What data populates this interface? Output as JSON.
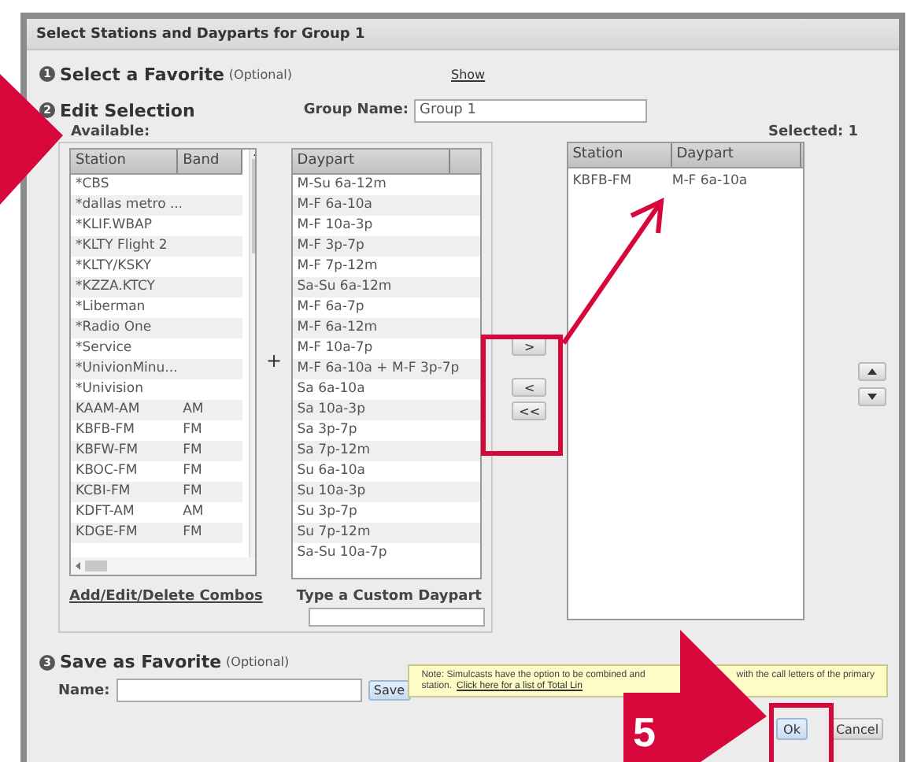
{
  "window": {
    "title": "Select Stations and Dayparts for Group 1"
  },
  "favorite": {
    "number": "1",
    "title": "Select a Favorite",
    "hint": "(Optional)",
    "link": "Show"
  },
  "edit": {
    "number": "2",
    "title": "Edit Selection",
    "group_label": "Group Name:",
    "group_value": "Group 1",
    "available_label": "Available:",
    "selected_label": "Selected: 1"
  },
  "stations": {
    "columns": [
      "Station",
      "Band"
    ],
    "rows": [
      {
        "station": "*CBS",
        "band": ""
      },
      {
        "station": "*dallas metro ...",
        "band": ""
      },
      {
        "station": "*KLIF.WBAP",
        "band": ""
      },
      {
        "station": "*KLTY Flight 2",
        "band": ""
      },
      {
        "station": "*KLTY/KSKY",
        "band": ""
      },
      {
        "station": "*KZZA.KTCY",
        "band": ""
      },
      {
        "station": "*Liberman",
        "band": ""
      },
      {
        "station": "*Radio One",
        "band": ""
      },
      {
        "station": "*Service",
        "band": ""
      },
      {
        "station": "*UnivionMinu...",
        "band": ""
      },
      {
        "station": "*Univision",
        "band": ""
      },
      {
        "station": "KAAM-AM",
        "band": "AM"
      },
      {
        "station": "KBFB-FM",
        "band": "FM"
      },
      {
        "station": "KBFW-FM",
        "band": "FM"
      },
      {
        "station": "KBOC-FM",
        "band": "FM"
      },
      {
        "station": "KCBI-FM",
        "band": "FM"
      },
      {
        "station": "KDFT-AM",
        "band": "AM"
      },
      {
        "station": "KDGE-FM",
        "band": "FM"
      }
    ]
  },
  "plus": "+",
  "dayparts": {
    "column": "Daypart",
    "rows": [
      "M-Su 6a-12m",
      "M-F 6a-10a",
      "M-F 10a-3p",
      "M-F 3p-7p",
      "M-F 7p-12m",
      "Sa-Su 6a-12m",
      "M-F 6a-7p",
      "M-F 6a-12m",
      "M-F 10a-7p",
      "M-F 6a-10a + M-F 3p-7p",
      "Sa 6a-10a",
      "Sa 10a-3p",
      "Sa 3p-7p",
      "Sa 7p-12m",
      "Su 6a-10a",
      "Su 10a-3p",
      "Su 3p-7p",
      "Su 7p-12m",
      "Sa-Su 10a-7p"
    ]
  },
  "combos_link": "Add/Edit/Delete Combos",
  "custom_label": "Type a Custom Daypart",
  "move_buttons": [
    ">",
    "<",
    "<<"
  ],
  "selected": {
    "columns": [
      "Station",
      "Daypart"
    ],
    "rows": [
      {
        "station": "KBFB-FM",
        "daypart": "M-F 6a-10a"
      }
    ]
  },
  "save": {
    "number": "3",
    "title": "Save as Favorite",
    "hint": "(Optional)",
    "name_label": "Name:",
    "button": "Save"
  },
  "note": {
    "line1_start": "Note: Simulcasts have the option to be combined and",
    "line1_end": "with the call letters of the primary",
    "line2": "station.",
    "link": "Click here for a list of Total Lin"
  },
  "buttons": [
    "Ok",
    "Cancel"
  ],
  "annotation": {
    "step": "5"
  }
}
